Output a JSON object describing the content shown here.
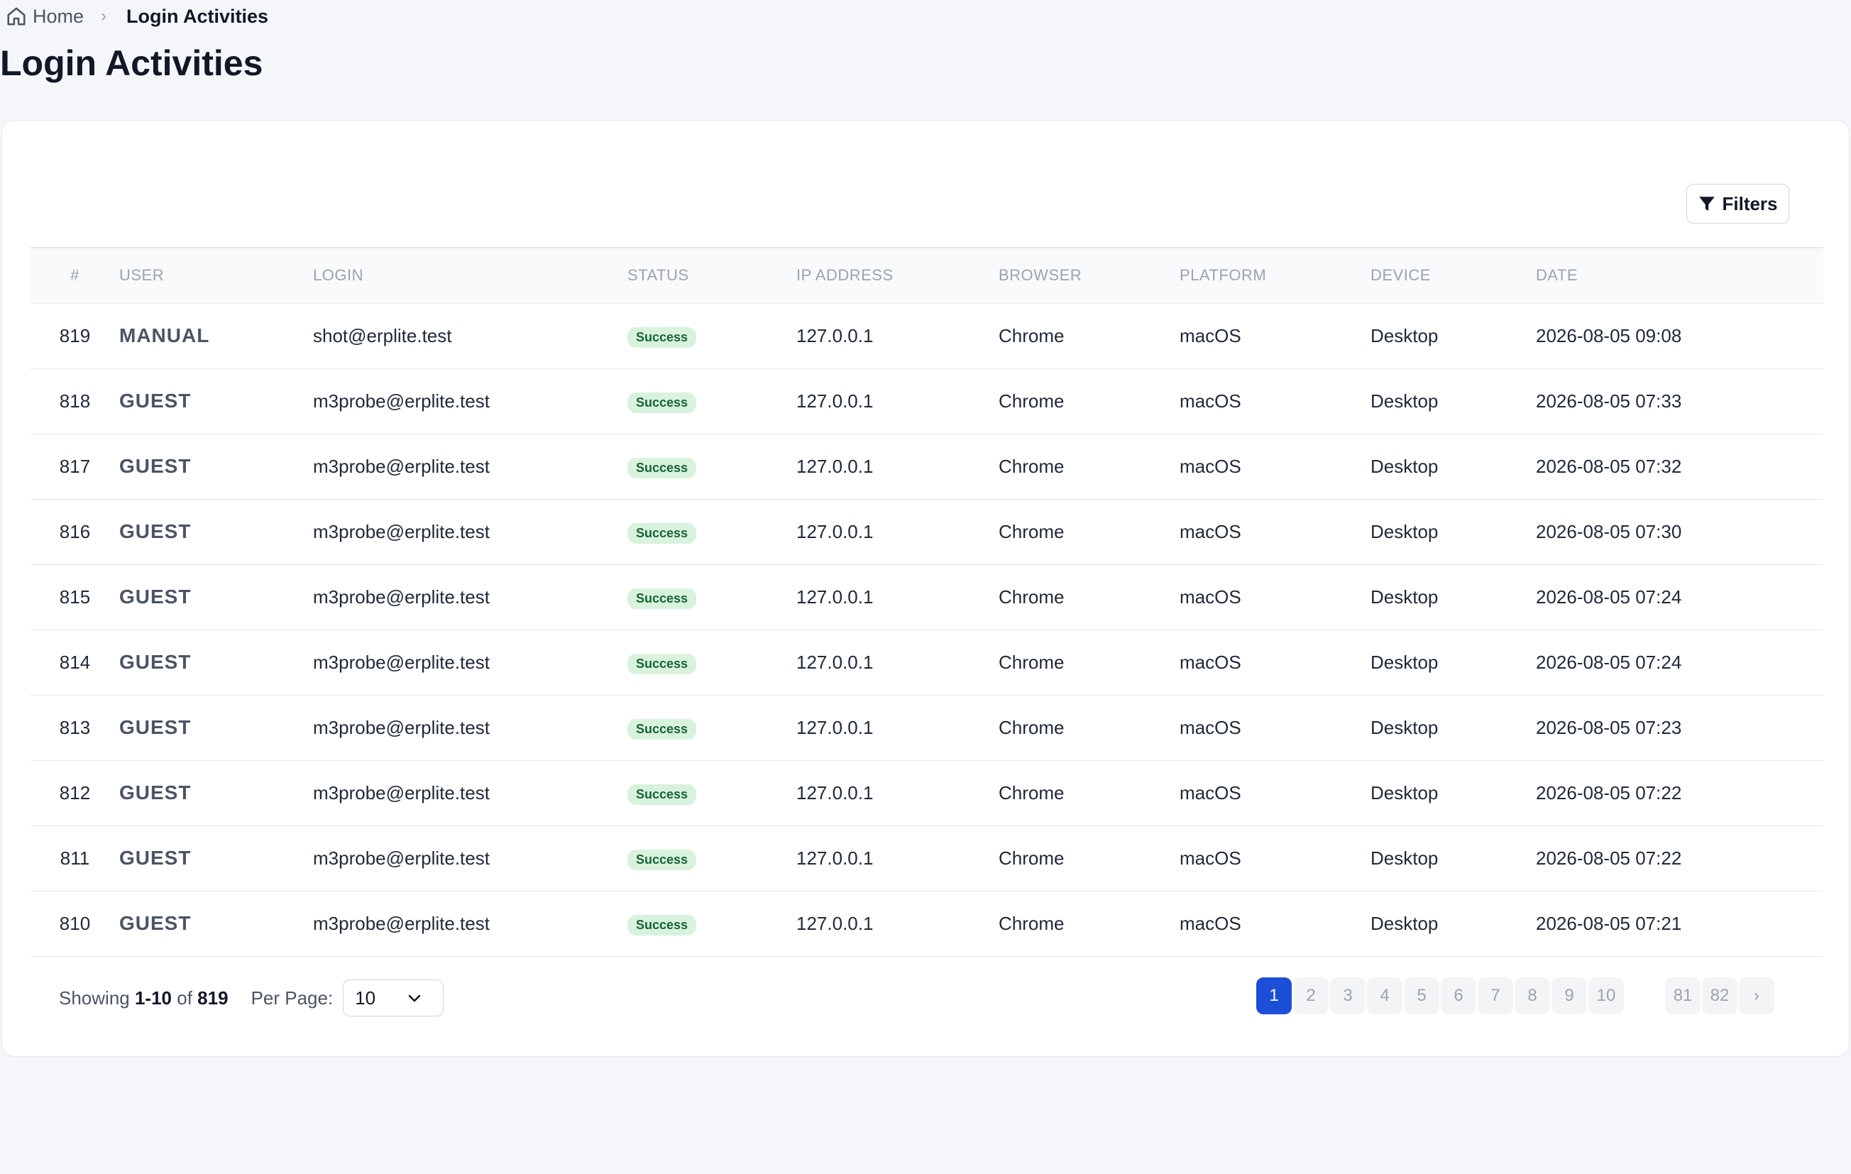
{
  "breadcrumb": {
    "home": "Home",
    "current": "Login Activities"
  },
  "page_title": "Login Activities",
  "toolbar": {
    "filters_label": "Filters"
  },
  "table": {
    "headers": {
      "num": "#",
      "user": "USER",
      "login": "LOGIN",
      "status": "STATUS",
      "ip": "IP ADDRESS",
      "browser": "BROWSER",
      "platform": "PLATFORM",
      "device": "DEVICE",
      "date": "DATE"
    },
    "rows": [
      {
        "num": "819",
        "user": "MANUAL",
        "login": "shot@erplite.test",
        "status": "Success",
        "ip": "127.0.0.1",
        "browser": "Chrome",
        "platform": "macOS",
        "device": "Desktop",
        "date": "2026-08-05 09:08"
      },
      {
        "num": "818",
        "user": "GUEST",
        "login": "m3probe@erplite.test",
        "status": "Success",
        "ip": "127.0.0.1",
        "browser": "Chrome",
        "platform": "macOS",
        "device": "Desktop",
        "date": "2026-08-05 07:33"
      },
      {
        "num": "817",
        "user": "GUEST",
        "login": "m3probe@erplite.test",
        "status": "Success",
        "ip": "127.0.0.1",
        "browser": "Chrome",
        "platform": "macOS",
        "device": "Desktop",
        "date": "2026-08-05 07:32"
      },
      {
        "num": "816",
        "user": "GUEST",
        "login": "m3probe@erplite.test",
        "status": "Success",
        "ip": "127.0.0.1",
        "browser": "Chrome",
        "platform": "macOS",
        "device": "Desktop",
        "date": "2026-08-05 07:30"
      },
      {
        "num": "815",
        "user": "GUEST",
        "login": "m3probe@erplite.test",
        "status": "Success",
        "ip": "127.0.0.1",
        "browser": "Chrome",
        "platform": "macOS",
        "device": "Desktop",
        "date": "2026-08-05 07:24"
      },
      {
        "num": "814",
        "user": "GUEST",
        "login": "m3probe@erplite.test",
        "status": "Success",
        "ip": "127.0.0.1",
        "browser": "Chrome",
        "platform": "macOS",
        "device": "Desktop",
        "date": "2026-08-05 07:24"
      },
      {
        "num": "813",
        "user": "GUEST",
        "login": "m3probe@erplite.test",
        "status": "Success",
        "ip": "127.0.0.1",
        "browser": "Chrome",
        "platform": "macOS",
        "device": "Desktop",
        "date": "2026-08-05 07:23"
      },
      {
        "num": "812",
        "user": "GUEST",
        "login": "m3probe@erplite.test",
        "status": "Success",
        "ip": "127.0.0.1",
        "browser": "Chrome",
        "platform": "macOS",
        "device": "Desktop",
        "date": "2026-08-05 07:22"
      },
      {
        "num": "811",
        "user": "GUEST",
        "login": "m3probe@erplite.test",
        "status": "Success",
        "ip": "127.0.0.1",
        "browser": "Chrome",
        "platform": "macOS",
        "device": "Desktop",
        "date": "2026-08-05 07:22"
      },
      {
        "num": "810",
        "user": "GUEST",
        "login": "m3probe@erplite.test",
        "status": "Success",
        "ip": "127.0.0.1",
        "browser": "Chrome",
        "platform": "macOS",
        "device": "Desktop",
        "date": "2026-08-05 07:21"
      }
    ]
  },
  "footer": {
    "showing_prefix": "Showing",
    "range": "1-10",
    "of_label": "of",
    "total": "819",
    "per_page_label": "Per Page:",
    "per_page_value": "10"
  },
  "pagination": {
    "pages": [
      "1",
      "2",
      "3",
      "4",
      "5",
      "6",
      "7",
      "8",
      "9",
      "10"
    ],
    "active": "1",
    "tail_pages": [
      "81",
      "82"
    ],
    "next": "›"
  },
  "colors": {
    "accent": "#1d4ed8",
    "success_bg": "#d9f2dd",
    "success_text": "#166534"
  }
}
